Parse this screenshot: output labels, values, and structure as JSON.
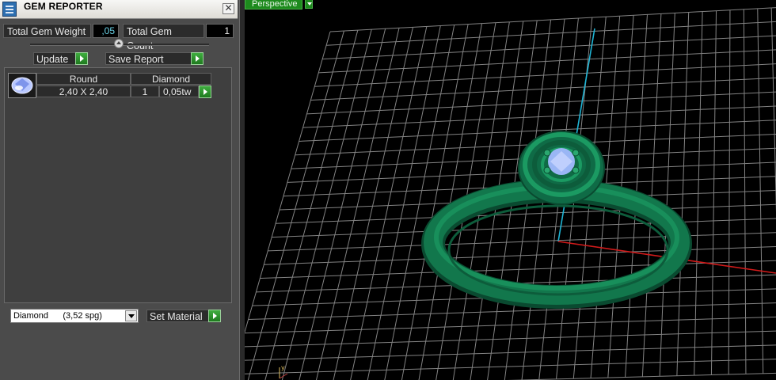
{
  "panel": {
    "title": "GEM REPORTER",
    "close_glyph": "✕",
    "total_gem_weight_label": "Total Gem Weight",
    "total_gem_weight_value": ",05",
    "total_gem_count_label": "Total Gem Count",
    "total_gem_count_value": "1",
    "update_label": "Update",
    "save_report_label": "Save Report",
    "gem_row": {
      "shape": "Round",
      "type": "Diamond",
      "size": "2,40 X 2,40",
      "count": "1",
      "weight": "0,05tw"
    },
    "material_select_value": "Diamond      (3,52 spg)",
    "set_material_label": "Set Material"
  },
  "viewport": {
    "view_name": "Perspective",
    "colors": {
      "grid": "#9a9a9a",
      "ring": "#0f6b46",
      "gem": "#9ab6f5",
      "axis_y": "#1fb4d4",
      "axis_x": "#d21a1a",
      "view_label_bg": "#1d8a1d"
    }
  },
  "icons": [
    "app-icon",
    "close-icon",
    "slider-knob",
    "arrow-right-icon",
    "gem-thumbnail",
    "dropdown-arrow-icon",
    "axis-gizmo"
  ]
}
